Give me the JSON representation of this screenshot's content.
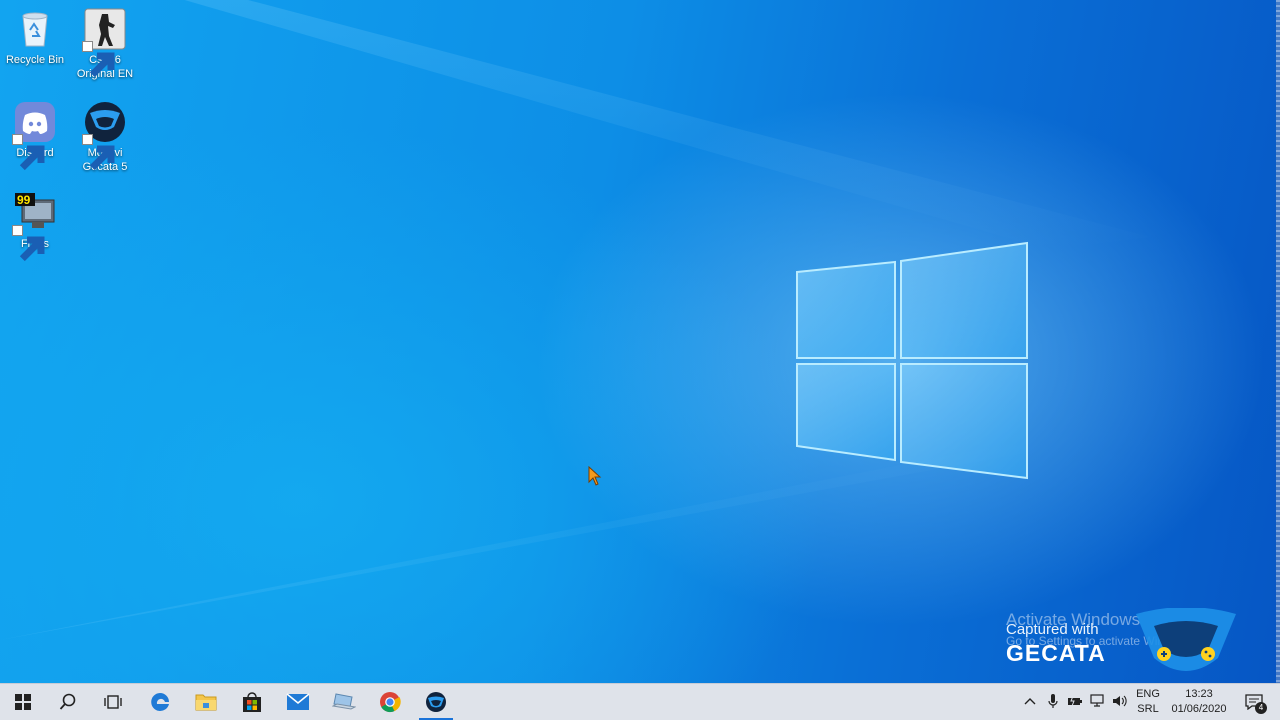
{
  "desktop": {
    "icons": [
      {
        "label": "Recycle Bin",
        "icon": "recycle-bin-icon"
      },
      {
        "label": "Cs 1.6 Original EN",
        "icon": "counter-strike-icon"
      },
      {
        "label": "Discord",
        "icon": "discord-icon"
      },
      {
        "label": "Movavi Gecata 5",
        "icon": "gecata-icon"
      },
      {
        "label": "Fraps",
        "icon": "fraps-icon"
      }
    ]
  },
  "watermark": {
    "activate_title": "Activate Windows",
    "activate_sub": "Go to Settings to activate Windows.",
    "captured_with": "Captured with",
    "brand": "GECATA"
  },
  "taskbar": {
    "buttons": [
      {
        "name": "start",
        "icon": "windows-start-icon"
      },
      {
        "name": "search",
        "icon": "search-icon"
      },
      {
        "name": "task-view",
        "icon": "task-view-icon"
      },
      {
        "name": "edge",
        "icon": "edge-icon"
      },
      {
        "name": "file-explorer",
        "icon": "folder-icon"
      },
      {
        "name": "store",
        "icon": "store-icon"
      },
      {
        "name": "mail",
        "icon": "mail-icon"
      },
      {
        "name": "app",
        "icon": "laptop-icon"
      },
      {
        "name": "chrome",
        "icon": "chrome-icon"
      },
      {
        "name": "gecata",
        "icon": "gecata-icon"
      }
    ],
    "tray": {
      "icons": [
        "chevron-up-icon",
        "microphone-icon",
        "battery-icon",
        "network-icon",
        "volume-icon"
      ],
      "lang_line1": "ENG",
      "lang_line2": "SRL",
      "time": "13:23",
      "date": "01/06/2020",
      "notification_count": "4"
    }
  },
  "colors": {
    "accent": "#1a73d9",
    "taskbar_bg": "#dfe3ea"
  }
}
